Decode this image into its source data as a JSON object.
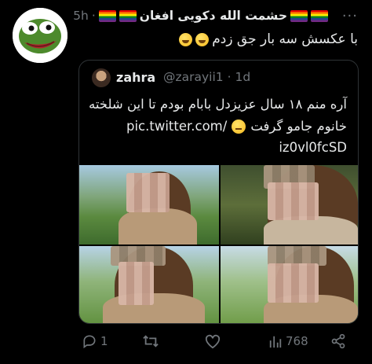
{
  "tweet": {
    "author_name": "حشمت الله دکویی افغان",
    "separator": "·",
    "time": "5h",
    "more_label": "···",
    "text": "با عکسش سه بار جق زدم"
  },
  "quoted": {
    "name": "zahra",
    "handle": "@zarayii1",
    "separator": "·",
    "time": "1d",
    "line1": "آره منم ۱۸ سال عزیزدل بابام بودم تا این شلخته",
    "line2_text": "خانوم جامو گرفت",
    "line2_link": "pic.twitter.com/",
    "line3_link": "iz0vl0fcSD"
  },
  "actions": {
    "replies": "1",
    "retweets": "",
    "likes": "",
    "views": "768"
  },
  "icons": [
    "more-icon",
    "reply-icon",
    "retweet-icon",
    "like-icon",
    "views-icon",
    "share-icon"
  ]
}
